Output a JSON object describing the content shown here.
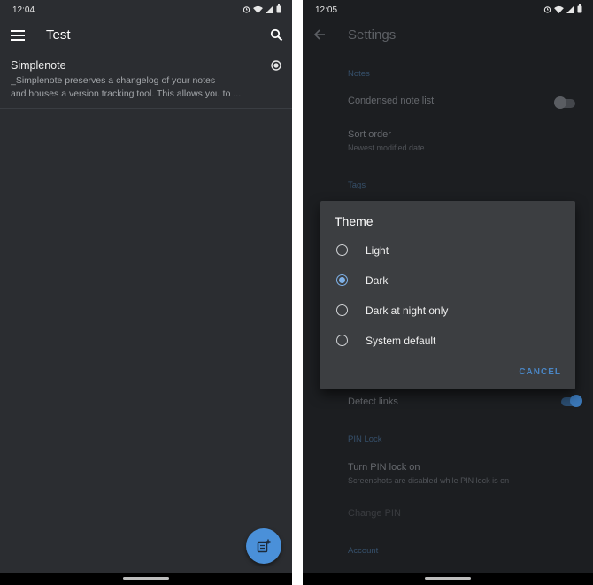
{
  "left_screen": {
    "status": {
      "time": "12:04"
    },
    "appbar": {
      "title": "Test"
    },
    "note": {
      "title": "Simplenote",
      "line1": "_Simplenote preserves a changelog of your notes",
      "line2": "and houses a version tracking tool. This allows you to ..."
    }
  },
  "right_screen": {
    "status": {
      "time": "12:05"
    },
    "appbar": {
      "title": "Settings"
    },
    "sections": {
      "notes": "Notes",
      "tags": "Tags",
      "pin_lock": "PIN Lock",
      "account": "Account"
    },
    "items": {
      "condensed": "Condensed note list",
      "sort_order": "Sort order",
      "sort_order_value": "Newest modified date",
      "detect_links": "Detect links",
      "turn_pin": "Turn PIN lock on",
      "turn_pin_sub": "Screenshots are disabled while PIN lock is on",
      "change_pin": "Change PIN"
    },
    "toggles": {
      "condensed_note_list": false,
      "detect_links": true
    },
    "dialog": {
      "title": "Theme",
      "options": [
        {
          "label": "Light",
          "selected": false
        },
        {
          "label": "Dark",
          "selected": true
        },
        {
          "label": "Dark at night only",
          "selected": false
        },
        {
          "label": "System default",
          "selected": false
        }
      ],
      "cancel": "CANCEL"
    }
  },
  "colors": {
    "accent": "#4a90d9",
    "dialog_bg": "#3c3e41",
    "screen_bg_left": "#2b2d31",
    "screen_bg_right": "#1c1e21"
  }
}
